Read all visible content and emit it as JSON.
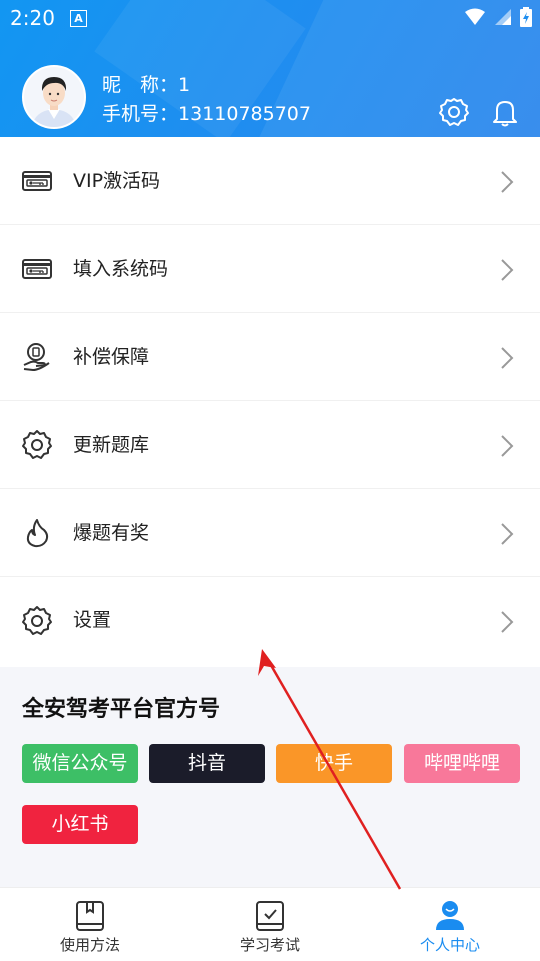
{
  "status": {
    "time": "2:20",
    "notif_icon": "a-notification-icon"
  },
  "profile": {
    "nick_label": "昵　称：",
    "nick_value": "1",
    "phone_label": "手机号：",
    "phone_value": "13110785707"
  },
  "menu": [
    {
      "label": "VIP激活码",
      "icon": "activation-card-icon"
    },
    {
      "label": "填入系统码",
      "icon": "system-code-card-icon"
    },
    {
      "label": "补偿保障",
      "icon": "compensation-hand-icon"
    },
    {
      "label": "更新题库",
      "icon": "gear-icon"
    },
    {
      "label": "爆题有奖",
      "icon": "flame-icon"
    },
    {
      "label": "设置",
      "icon": "gear-icon"
    }
  ],
  "social": {
    "title": "全安驾考平台官方号",
    "chips": [
      {
        "label": "微信公众号",
        "color": "#3dbf66"
      },
      {
        "label": "抖音",
        "color": "#1b1c2a"
      },
      {
        "label": "快手",
        "color": "#fa9628"
      },
      {
        "label": "哔哩哔哩",
        "color": "#f8789a"
      },
      {
        "label": "小红书",
        "color": "#f0233f"
      }
    ]
  },
  "tabs": [
    {
      "label": "使用方法",
      "icon": "book-icon",
      "active": false
    },
    {
      "label": "学习考试",
      "icon": "checklist-icon",
      "active": false
    },
    {
      "label": "个人中心",
      "icon": "person-icon",
      "active": true
    }
  ],
  "colors": {
    "accent": "#1a8cf0",
    "active_tab": "#1a8cf0",
    "annotation_arrow": "#e02020"
  }
}
